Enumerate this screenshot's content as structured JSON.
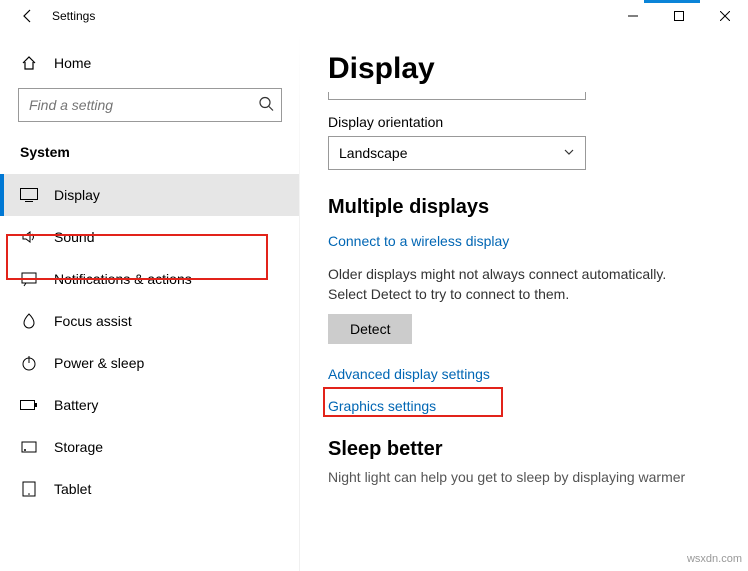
{
  "window": {
    "title": "Settings"
  },
  "sidebar": {
    "home_label": "Home",
    "search_placeholder": "Find a setting",
    "section_label": "System",
    "items": [
      {
        "label": "Display"
      },
      {
        "label": "Sound"
      },
      {
        "label": "Notifications & actions"
      },
      {
        "label": "Focus assist"
      },
      {
        "label": "Power & sleep"
      },
      {
        "label": "Battery"
      },
      {
        "label": "Storage"
      },
      {
        "label": "Tablet"
      }
    ]
  },
  "main": {
    "title": "Display",
    "orientation_label": "Display orientation",
    "orientation_value": "Landscape",
    "multi_heading": "Multiple displays",
    "wireless_link": "Connect to a wireless display",
    "detect_text": "Older displays might not always connect automatically. Select Detect to try to connect to them.",
    "detect_button": "Detect",
    "advanced_link": "Advanced display settings",
    "graphics_link": "Graphics settings",
    "sleep_heading": "Sleep better",
    "sleep_text": "Night light can help you get to sleep by displaying warmer"
  },
  "watermark": "wsxdn.com"
}
